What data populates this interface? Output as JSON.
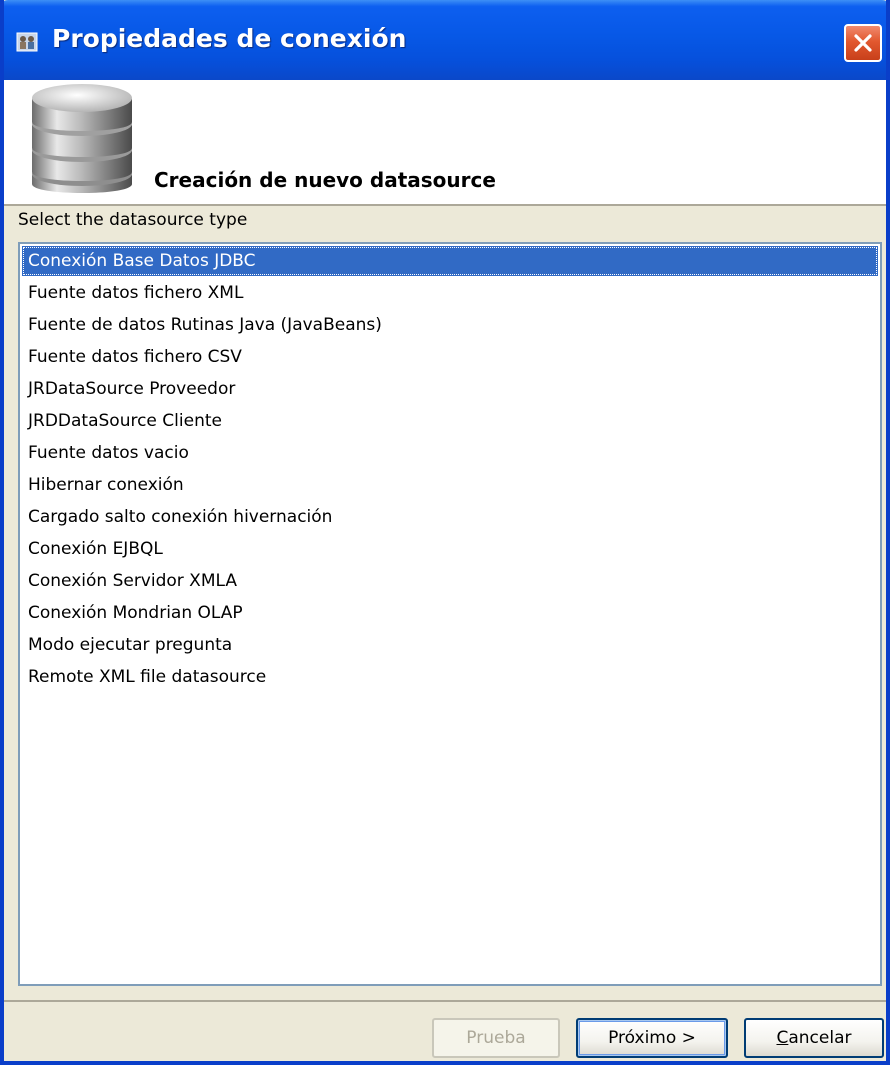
{
  "window": {
    "title": "Propiedades de conexión",
    "title_icon": "connection-properties-icon",
    "close_icon": "close-icon"
  },
  "header": {
    "title": "Creación de nuevo datasource",
    "icon": "database-icon"
  },
  "prompt": "Select the datasource type",
  "datasource_types": {
    "selected_index": 0,
    "items": [
      "Conexión Base Datos JDBC",
      "Fuente datos fichero XML",
      "Fuente de datos Rutinas Java (JavaBeans)",
      "Fuente datos fichero CSV",
      "JRDataSource Proveedor",
      "JRDDataSource Cliente",
      "Fuente datos vacio",
      "Hibernar conexión",
      "Cargado salto conexión hivernación",
      "Conexión EJBQL",
      "Conexión Servidor XMLA",
      "Conexión Mondrian OLAP",
      "Modo ejecutar pregunta",
      "Remote XML file datasource"
    ]
  },
  "buttons": {
    "test": "Prueba",
    "next": "Próximo >",
    "cancel_first": "C",
    "cancel_rest": "ancelar"
  },
  "colors": {
    "title_bar": "#0758e6",
    "selection": "#316ac5",
    "dialog_bg": "#ece9d8",
    "close_button": "#e2582f"
  }
}
